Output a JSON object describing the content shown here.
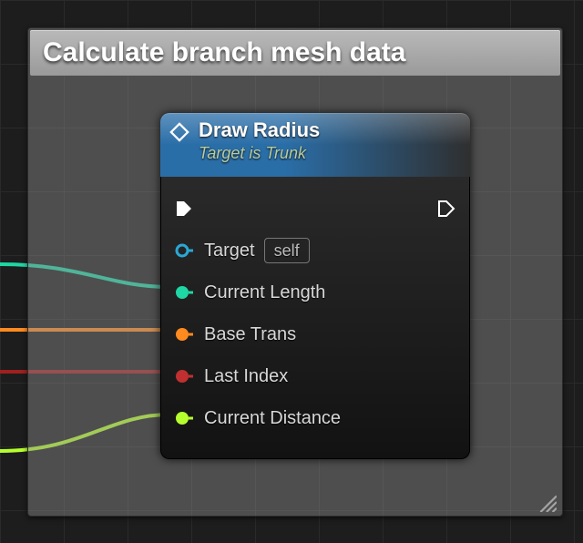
{
  "comment": {
    "title": "Calculate branch mesh data"
  },
  "node": {
    "title": "Draw Radius",
    "subtitle": "Target is Trunk",
    "pins": {
      "target": {
        "label": "Target",
        "self": "self",
        "color": "#2aa7d4"
      },
      "current_length": {
        "label": "Current Length",
        "color": "#1fd6a5"
      },
      "base_trans": {
        "label": "Base Trans",
        "color": "#ff8a1f"
      },
      "last_index": {
        "label": "Last Index",
        "color": "#c03030"
      },
      "current_distance": {
        "label": "Current Distance",
        "color": "#b6ff2e"
      }
    }
  },
  "wires": [
    {
      "to": "current_length",
      "color": "#1fd6a5"
    },
    {
      "to": "base_trans",
      "color": "#ff8a1f"
    },
    {
      "to": "last_index",
      "color": "#c03030"
    },
    {
      "to": "current_distance",
      "color": "#b6ff2e"
    }
  ]
}
